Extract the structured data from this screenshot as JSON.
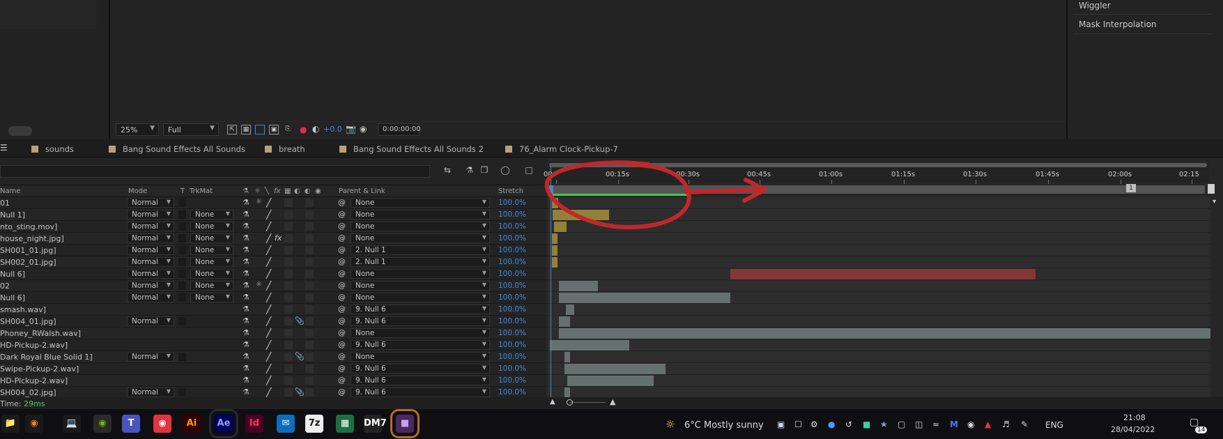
{
  "right_panel": {
    "items": [
      "Wiggler",
      "Mask Interpolation"
    ]
  },
  "viewer_bar": {
    "zoom": "25%",
    "resolution": "Full",
    "exposure": "+0.0",
    "timecode": "0:00:00:00"
  },
  "tabs": [
    "sounds",
    "Bang Sound Effects All Sounds",
    "breath",
    "Bang Sound Effects All Sounds 2",
    "76_Alarm Clock-Pickup-7"
  ],
  "columns": {
    "name": "Name",
    "mode": "Mode",
    "t": "T",
    "trkmat": "TrkMat",
    "parent": "Parent & Link",
    "stretch": "Stretch"
  },
  "rows": [
    {
      "name": "01",
      "mode": "Normal",
      "trkmat": "",
      "parent": "None",
      "stretch": "100.0%"
    },
    {
      "name": "Null 1]",
      "mode": "Normal",
      "trkmat": "None",
      "parent": "None",
      "stretch": "100.0%"
    },
    {
      "name": "nto_sting.mov]",
      "mode": "Normal",
      "trkmat": "None",
      "parent": "None",
      "stretch": "100.0%"
    },
    {
      "name": "house_night.jpg]",
      "mode": "Normal",
      "trkmat": "None",
      "parent": "None",
      "stretch": "100.0%"
    },
    {
      "name": "SH001_01.jpg]",
      "mode": "Normal",
      "trkmat": "None",
      "parent": "2. Null 1",
      "stretch": "100.0%"
    },
    {
      "name": "SH002_01.jpg]",
      "mode": "Normal",
      "trkmat": "None",
      "parent": "2. Null 1",
      "stretch": "100.0%"
    },
    {
      "name": "Null 6]",
      "mode": "Normal",
      "trkmat": "None",
      "parent": "None",
      "stretch": "100.0%"
    },
    {
      "name": "02",
      "mode": "Normal",
      "trkmat": "None",
      "parent": "None",
      "stretch": "100.0%"
    },
    {
      "name": "Null 6]",
      "mode": "Normal",
      "trkmat": "None",
      "parent": "None",
      "stretch": "100.0%"
    },
    {
      "name": "smash.wav]",
      "mode": "",
      "trkmat": "",
      "parent": "9. Null 6",
      "stretch": "100.0%"
    },
    {
      "name": "SH004_01.jpg]",
      "mode": "Normal",
      "trkmat": "",
      "parent": "9. Null 6",
      "stretch": "100.0%"
    },
    {
      "name": "Phoney_RWalsh.wav]",
      "mode": "",
      "trkmat": "",
      "parent": "None",
      "stretch": "100.0%"
    },
    {
      "name": "HD-Pickup-2.wav]",
      "mode": "",
      "trkmat": "",
      "parent": "9. Null 6",
      "stretch": "100.0%"
    },
    {
      "name": "Dark Royal Blue Solid 1]",
      "mode": "Normal",
      "trkmat": "",
      "parent": "None",
      "stretch": "100.0%"
    },
    {
      "name": "Swipe-Pickup-2.wav]",
      "mode": "",
      "trkmat": "",
      "parent": "9. Null 6",
      "stretch": "100.0%"
    },
    {
      "name": "HD-Pickup-2.wav]",
      "mode": "",
      "trkmat": "",
      "parent": "9. Null 6",
      "stretch": "100.0%"
    },
    {
      "name": "SH004_02.jpg]",
      "mode": "Normal",
      "trkmat": "",
      "parent": "9. Null 6",
      "stretch": "100.0%"
    }
  ],
  "time_label": "Time:",
  "time_value": "29ms",
  "ruler_ticks": [
    "00s",
    "00:15s",
    "00:30s",
    "00:45s",
    "01:00s",
    "01:15s",
    "01:30s",
    "01:45s",
    "02:00s",
    "02:15"
  ],
  "colors": {
    "label_tan": "#b8a079",
    "bar_gold": "#a08a3a",
    "bar_red": "#8e3838",
    "bar_grey": "#7a8886",
    "accent_blue": "#3f8ad8",
    "workarea_green": "#47c84e",
    "annotation_red": "#c0282a"
  },
  "taskbar": {
    "weather": "6°C  Mostly sunny",
    "lang": "ENG",
    "time": "21:08",
    "date": "28/04/2022",
    "notifications": "14",
    "apps": [
      "files",
      "firefox",
      "explorer",
      "nvidia",
      "teams",
      "creative-cloud",
      "Ai",
      "Ae",
      "Id",
      "outlook",
      "7z",
      "excel",
      "dm7",
      "app"
    ]
  }
}
